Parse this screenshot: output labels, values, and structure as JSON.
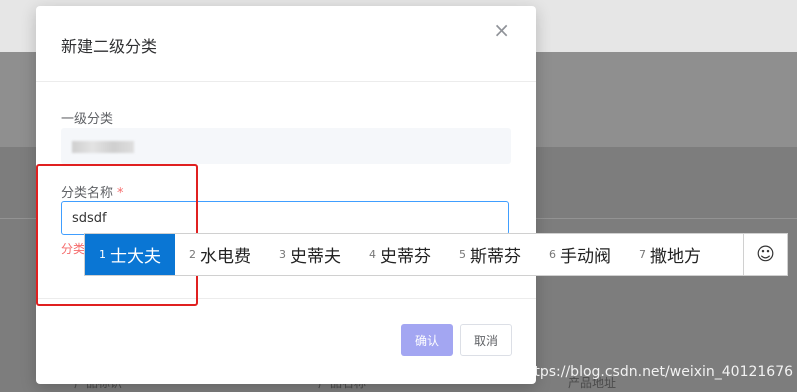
{
  "background": {
    "columns": [
      "产品标识",
      "产品名称",
      "产品地址"
    ]
  },
  "modal": {
    "title": "新建二级分类",
    "close_icon": "×",
    "field1": {
      "label": "一级分类",
      "value_obscured": true
    },
    "field2": {
      "label": "分类名称",
      "required_mark": "*",
      "value": "sdsdf",
      "error_visible_fragment": "分类"
    },
    "confirm_label": "确认",
    "cancel_label": "取消"
  },
  "ime": {
    "candidates": [
      {
        "num": "1",
        "text": "士大夫",
        "active": true
      },
      {
        "num": "2",
        "text": "水电费"
      },
      {
        "num": "3",
        "text": "史蒂夫"
      },
      {
        "num": "4",
        "text": "史蒂芬"
      },
      {
        "num": "5",
        "text": "斯蒂芬"
      },
      {
        "num": "6",
        "text": "手动阀"
      },
      {
        "num": "7",
        "text": "撒地方"
      }
    ],
    "emoji_icon": "☺"
  },
  "watermark": "https://blog.csdn.net/weixin_40121676",
  "colors": {
    "primary": "#409eff",
    "error": "#f56c6c",
    "ime_active": "#0a76d4",
    "annotation": "#e02020"
  }
}
